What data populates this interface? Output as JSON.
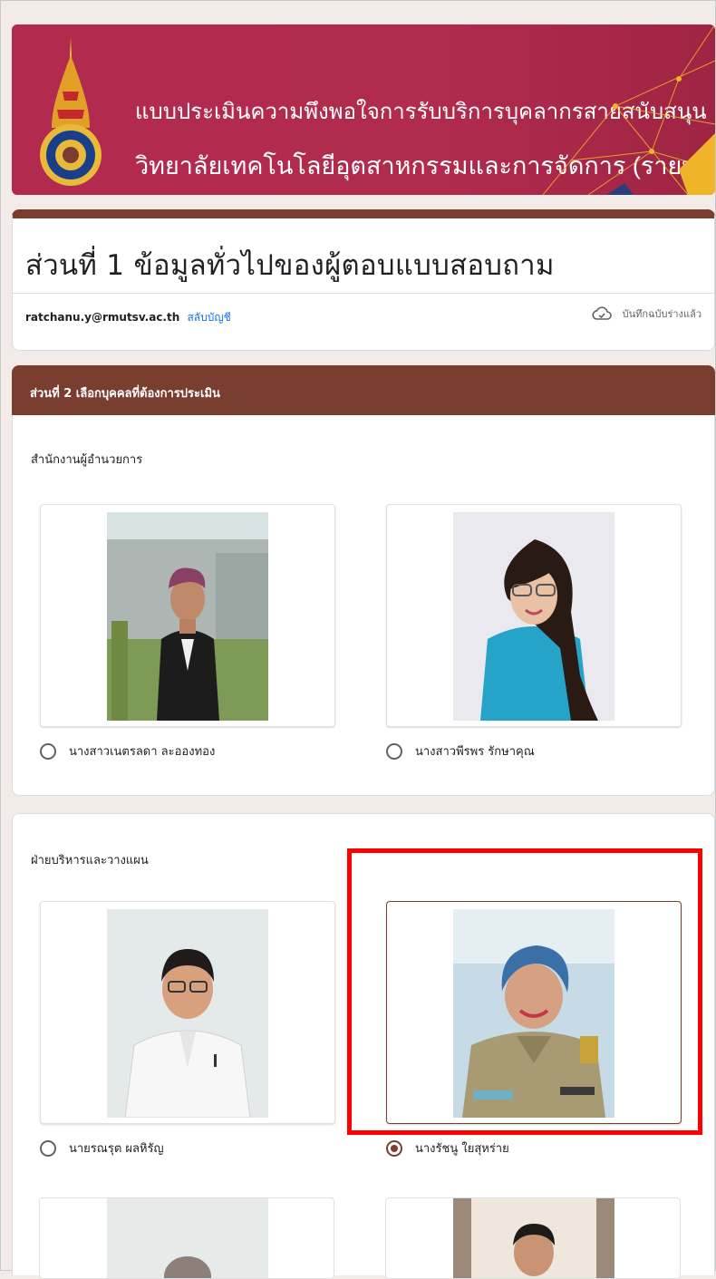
{
  "banner": {
    "line1": "แบบประเมินความพึงพอใจการรับบริการบุคลากรสายสนับสนุน",
    "line2": "วิทยาลัยเทคโนโลยีอุตสาหกรรมและการจัดการ (รายบุคคล)",
    "colors": {
      "background": "#b22b4e",
      "accent": "#f0b429"
    }
  },
  "form": {
    "title": "ส่วนที่ 1 ข้อมูลทั่วไปของผู้ตอบแบบสอบถาม",
    "email": "ratchanu.y@rmutsv.ac.th",
    "switch_account": "สลับบัญชี",
    "saved_status": "บันทึกฉบับร่างแล้ว",
    "saved_icon": "cloud-check-icon"
  },
  "section2": {
    "header": "ส่วนที่ 2 เลือกบุคคลที่ต้องการประเมิน",
    "questions": [
      {
        "title": "สำนักงานผู้อำนวยการ",
        "options": [
          {
            "label": "นางสาวเนตรลดา ละอองทอง",
            "selected": false
          },
          {
            "label": "นางสาวพีรพร รักษาคุณ",
            "selected": false
          }
        ]
      },
      {
        "title": "ฝ่ายบริหารและวางแผน",
        "options": [
          {
            "label": "นายรณรุต ผลหิรัญ",
            "selected": false
          },
          {
            "label": "นางรัชนู ใยสุหร่าย",
            "selected": true
          }
        ]
      }
    ]
  },
  "theme": {
    "primary": "#7a3e30",
    "page_bg": "#f3ebe7",
    "highlight": "#ff0000"
  }
}
